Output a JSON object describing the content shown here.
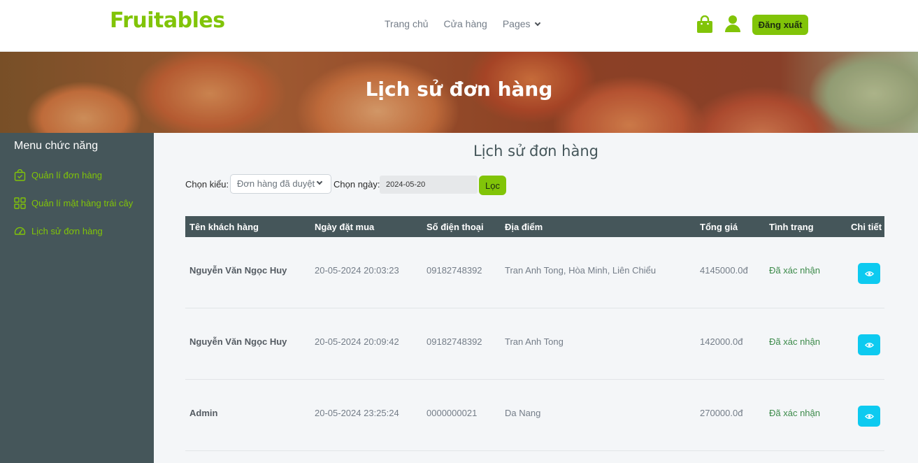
{
  "navbar": {
    "brand": "Fruitables",
    "links": [
      "Trang chủ",
      "Cửa hàng",
      "Pages"
    ],
    "logout_label": "Đăng xuất"
  },
  "hero": {
    "title": "Lịch sử đơn hàng"
  },
  "sidebar": {
    "title": "Menu chức năng",
    "items": [
      {
        "label": "Quản lí đơn hàng",
        "icon": "bag-check-icon"
      },
      {
        "label": "Quản lí mặt hàng trái cây",
        "icon": "grid-icon"
      },
      {
        "label": "Lịch sử đơn hàng",
        "icon": "speedometer-icon"
      }
    ]
  },
  "main": {
    "title": "Lịch sử đơn hàng",
    "filter": {
      "type_label": "Chọn kiểu:",
      "type_value": "Đơn hàng đã duyệt",
      "date_label": "Chọn ngày:",
      "date_value": "2024-05-20",
      "button_label": "Lọc"
    },
    "table": {
      "headers": [
        "Tên khách hàng",
        "Ngày đặt mua",
        "Số điện thoại",
        "Địa điểm",
        "Tổng giá",
        "Tình trạng",
        "Chi tiết"
      ],
      "rows": [
        [
          "Nguyễn Văn Ngọc Huy",
          "20-05-2024 20:03:23",
          "09182748392",
          "Tran Anh Tong, Hòa Minh, Liên Chiểu",
          "4145000.0đ",
          "Đã xác nhận"
        ],
        [
          "Nguyễn Văn Ngọc Huy",
          "20-05-2024 20:09:42",
          "09182748392",
          "Tran Anh Tong",
          "142000.0đ",
          "Đã xác nhận"
        ],
        [
          "Admin",
          "20-05-2024 23:25:24",
          "0000000021",
          "Da Nang",
          "270000.0đ",
          "Đã xác nhận"
        ]
      ]
    }
  },
  "colors": {
    "brand": "#81c408",
    "sidebar": "#45565a",
    "detail_button": "#0dcaf0",
    "status": "#3c8a4a"
  }
}
